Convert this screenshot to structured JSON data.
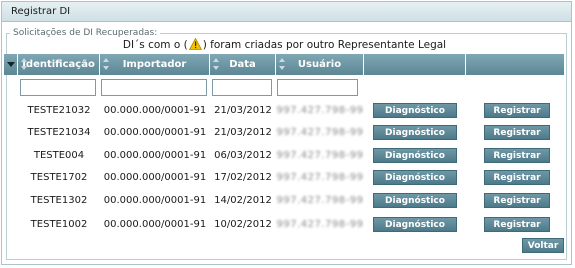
{
  "panel": {
    "title": "Registrar DI"
  },
  "fieldset": {
    "legend": "Solicitações de DI Recuperadas:"
  },
  "notice": {
    "before": "DI´s com o (",
    "after": ") foram criadas por outro Representante Legal"
  },
  "table": {
    "columns": [
      "Identificação",
      "Importador",
      "Data",
      "Usuário"
    ],
    "filters": [
      "",
      "",
      "",
      ""
    ],
    "rows": [
      {
        "id": "TESTE21032",
        "importador": "00.000.000/0001-91",
        "data": "21/03/2012",
        "usuario": "997.427.798-99"
      },
      {
        "id": "TESTE21034",
        "importador": "00.000.000/0001-91",
        "data": "21/03/2012",
        "usuario": "997.427.798-99"
      },
      {
        "id": "TESTE004",
        "importador": "00.000.000/0001-91",
        "data": "06/03/2012",
        "usuario": "997.427.798-99"
      },
      {
        "id": "TESTE1702",
        "importador": "00.000.000/0001-91",
        "data": "17/02/2012",
        "usuario": "997.427.798-99"
      },
      {
        "id": "TESTE1302",
        "importador": "00.000.000/0001-91",
        "data": "14/02/2012",
        "usuario": "997.427.798-99"
      },
      {
        "id": "TESTE1002",
        "importador": "00.000.000/0001-91",
        "data": "10/02/2012",
        "usuario": "997.427.798-99"
      }
    ],
    "diagnostico_label": "Diagnóstico",
    "registrar_label": "Registrar"
  },
  "footer": {
    "voltar_label": "Voltar"
  },
  "colors": {
    "header": "#5d8796",
    "button": "#4d7a8a",
    "warning": "#f2c200"
  }
}
